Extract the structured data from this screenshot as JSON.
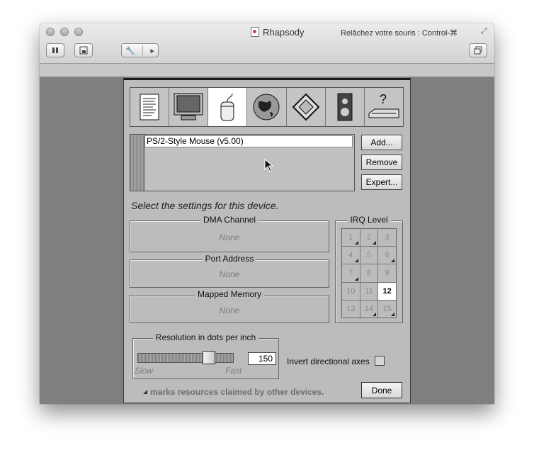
{
  "window": {
    "title": "Rhapsody",
    "hint": "Relâchez votre souris : Control-⌘"
  },
  "toolbar": {
    "pause_label": "Pause",
    "screenshot_label": "Screenshot",
    "settings_label": "Settings",
    "fullscreen_label": "Fullscreen"
  },
  "dialog": {
    "category_icons": [
      {
        "icon": "document-icon"
      },
      {
        "icon": "monitor-icon"
      },
      {
        "icon": "mouse-icon",
        "selected": true
      },
      {
        "icon": "globe-icon"
      },
      {
        "icon": "network-diamond-icon"
      },
      {
        "icon": "speaker-icon"
      },
      {
        "icon": "scsi-help-icon"
      }
    ],
    "devices": [
      "PS/2-Style Mouse (v5.00)"
    ],
    "buttons": {
      "add": "Add...",
      "remove": "Remove",
      "expert": "Expert...",
      "done": "Done"
    },
    "prompt": "Select the settings for this device.",
    "dma": {
      "label": "DMA Channel",
      "value": "None"
    },
    "port": {
      "label": "Port Address",
      "value": "None"
    },
    "memory": {
      "label": "Mapped Memory",
      "value": "None"
    },
    "irq": {
      "label": "IRQ Level",
      "levels": [
        "1",
        "2",
        "3",
        "4",
        "5",
        "6",
        "7",
        "8",
        "9",
        "10",
        "11",
        "12",
        "13",
        "14",
        "15"
      ],
      "claimed": [
        "1",
        "2",
        "4",
        "6",
        "7",
        "14",
        "15"
      ],
      "selected": "12"
    },
    "resolution": {
      "label": "Resolution in dots per inch",
      "value": "150",
      "slow_label": "Slow",
      "fast_label": "Fast",
      "level": 0.78
    },
    "invert_label": "Invert directional axes",
    "invert_checked": false,
    "footnote": "marks resources claimed by other devices."
  },
  "colors": {
    "accent_selected": "#ffffff",
    "dialog_bg": "#bcbcbc",
    "vm_bg": "#7f7f7f"
  }
}
